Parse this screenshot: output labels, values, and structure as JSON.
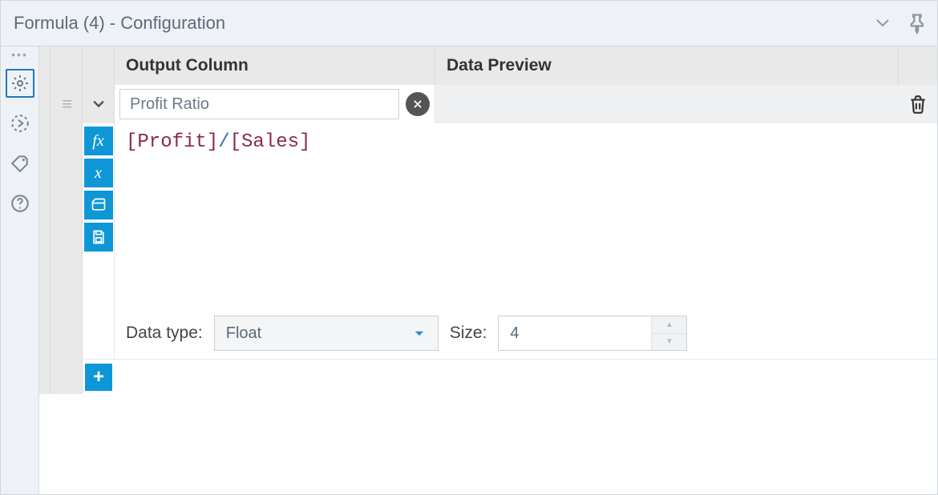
{
  "titlebar": {
    "title": "Formula (4) - Configuration"
  },
  "headers": {
    "output_column": "Output Column",
    "data_preview": "Data Preview"
  },
  "row": {
    "output_column_value": "Profit Ratio",
    "formula_tokens": {
      "t1": "[Profit]",
      "t2": "/",
      "t3": "[Sales]"
    },
    "data_type_label": "Data type:",
    "data_type_value": "Float",
    "size_label": "Size:",
    "size_value": "4"
  },
  "icons": {
    "fx": "fx",
    "x": "x",
    "plus": "+"
  }
}
